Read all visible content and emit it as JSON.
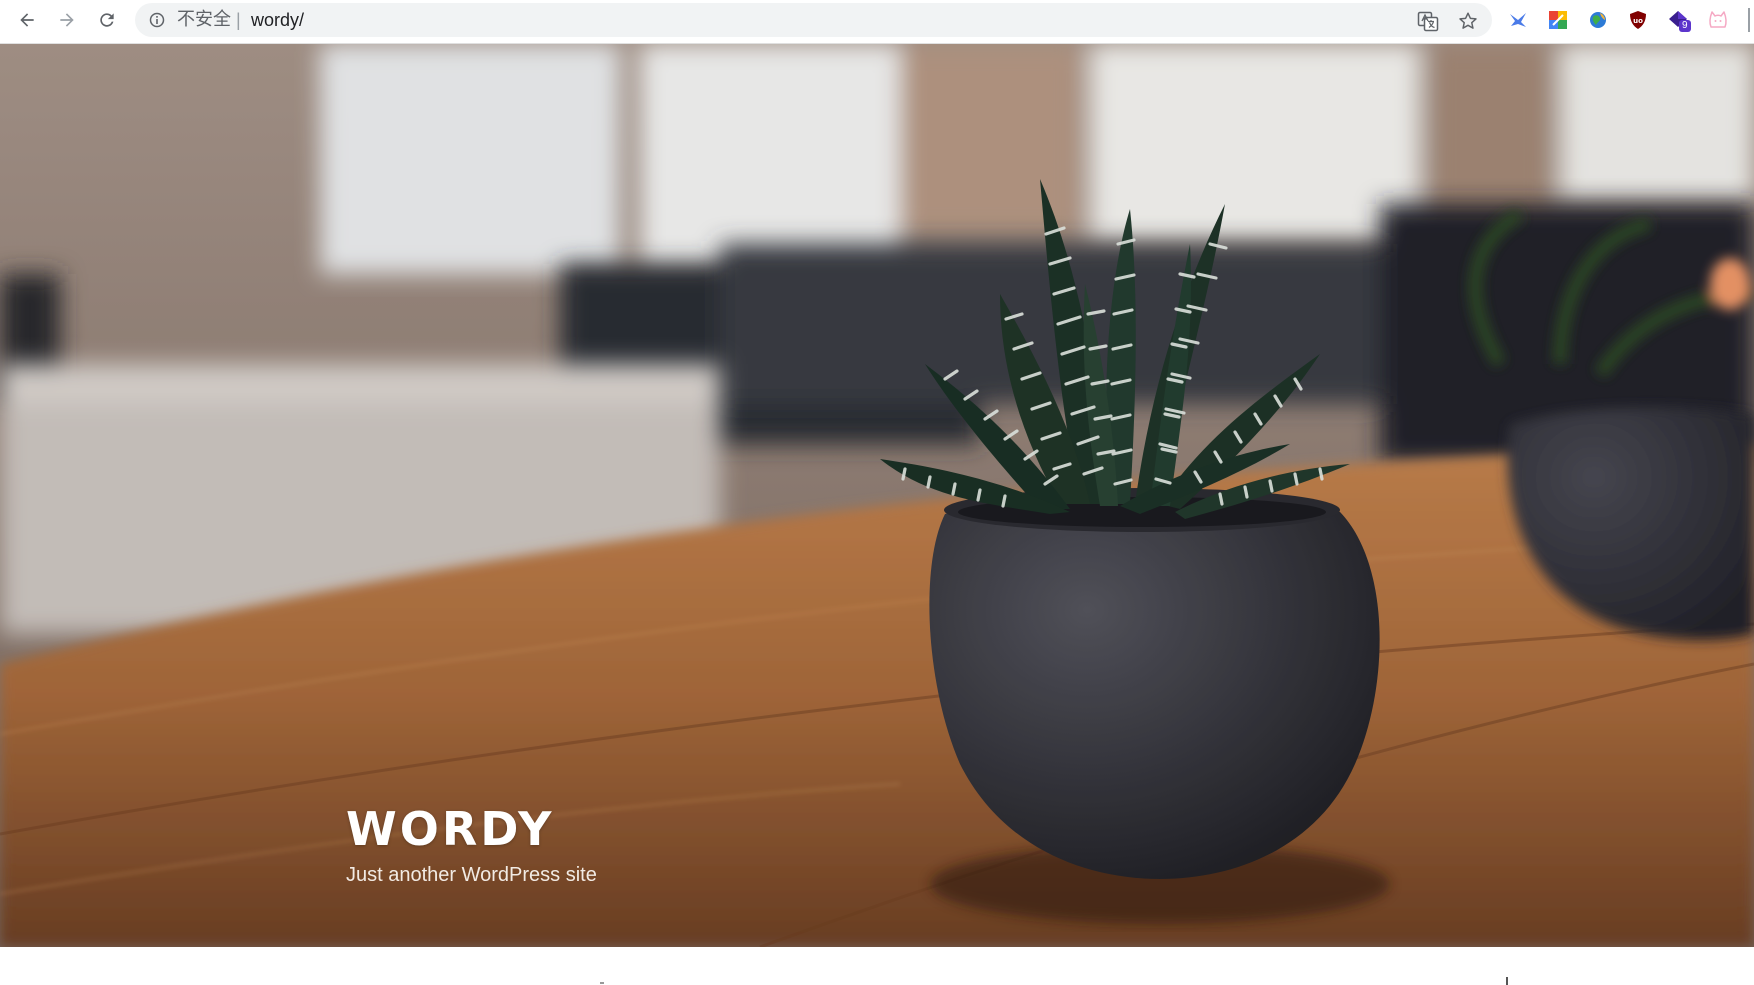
{
  "browser": {
    "security_label": "不安全",
    "separator": "|",
    "url": "wordy/",
    "buttons": {
      "back": "back-icon",
      "forward": "forward-icon",
      "reload": "reload-icon"
    },
    "extensions": [
      {
        "name": "blue-bird-extension-icon"
      },
      {
        "name": "colorful-squares-extension-icon"
      },
      {
        "name": "globe-extension-icon"
      },
      {
        "name": "ublock-origin-extension-icon"
      },
      {
        "name": "purple-diamond-extension-icon",
        "badge": "9"
      },
      {
        "name": "cat-face-extension-icon"
      }
    ],
    "badge_color": "#5c35cc"
  },
  "site": {
    "title": "WORDY",
    "description": "Just another WordPress site"
  },
  "colors": {
    "title": "#ffffff",
    "description": "#f2ebe4"
  }
}
